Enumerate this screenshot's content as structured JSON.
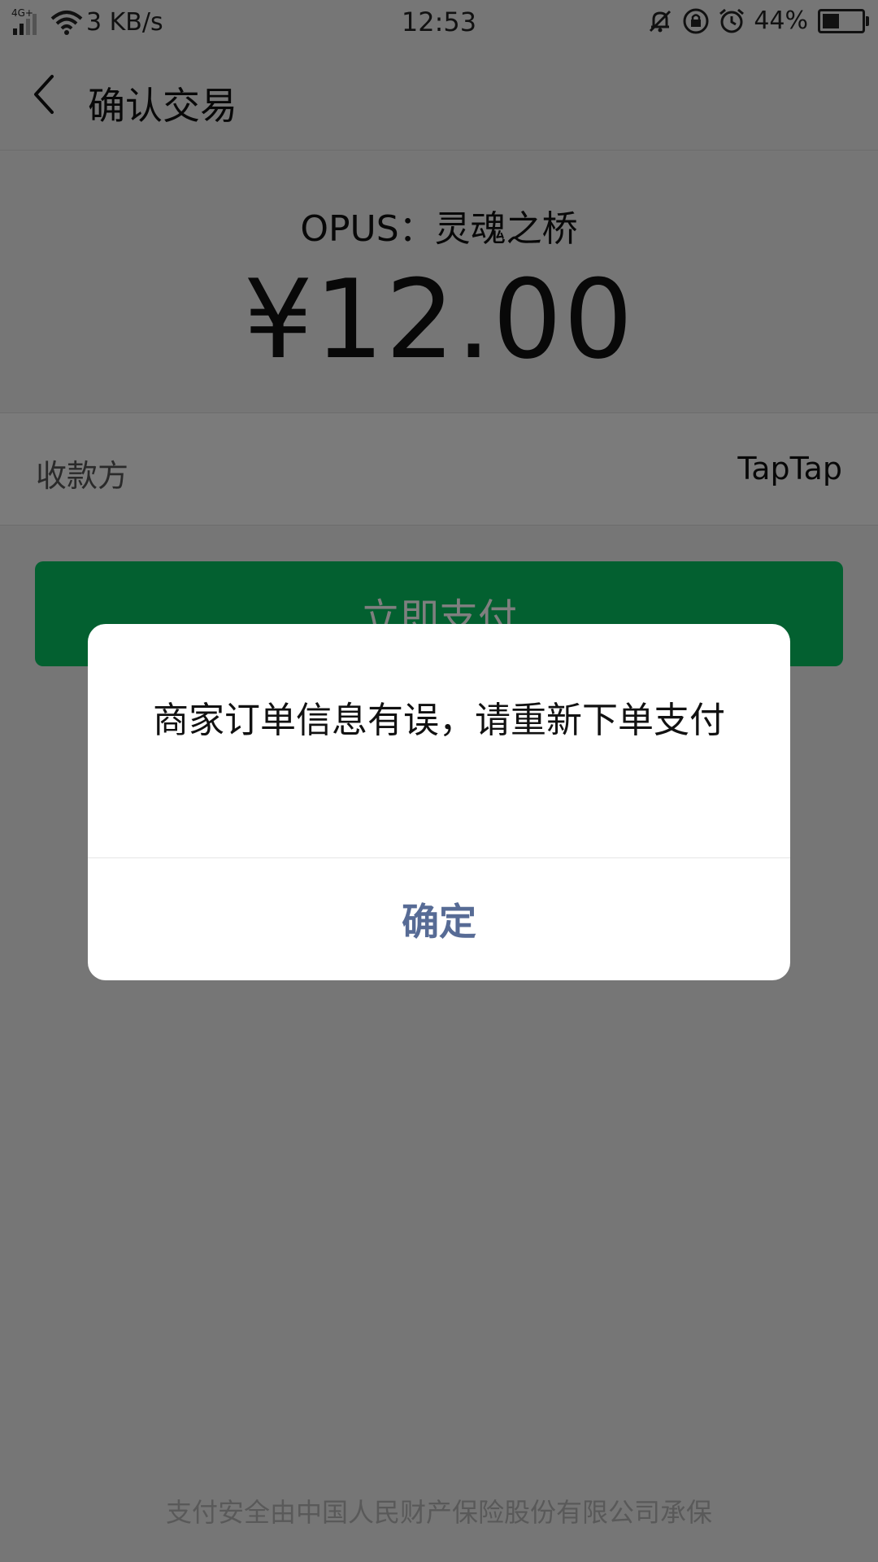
{
  "status_bar": {
    "network_type": "4G+",
    "speed": "3 KB/s",
    "time": "12:53",
    "battery_percent": "44%",
    "battery_level": 0.44,
    "icons": [
      "signal-icon",
      "wifi-icon",
      "mute-bell-icon",
      "rotation-lock-icon",
      "alarm-icon",
      "battery-icon"
    ]
  },
  "nav": {
    "title": "确认交易",
    "back_icon": "chevron-left-icon"
  },
  "summary": {
    "product_name": "OPUS：灵魂之桥",
    "amount": "¥12.00"
  },
  "payee": {
    "label": "收款方",
    "value": "TapTap"
  },
  "pay_button": {
    "label": "立即支付",
    "color": "#07c160"
  },
  "footer": {
    "note": "支付安全由中国人民财产保险股份有限公司承保"
  },
  "dialog": {
    "message": "商家订单信息有误，请重新下单支付",
    "confirm_label": "确定",
    "confirm_color": "#576b95"
  }
}
